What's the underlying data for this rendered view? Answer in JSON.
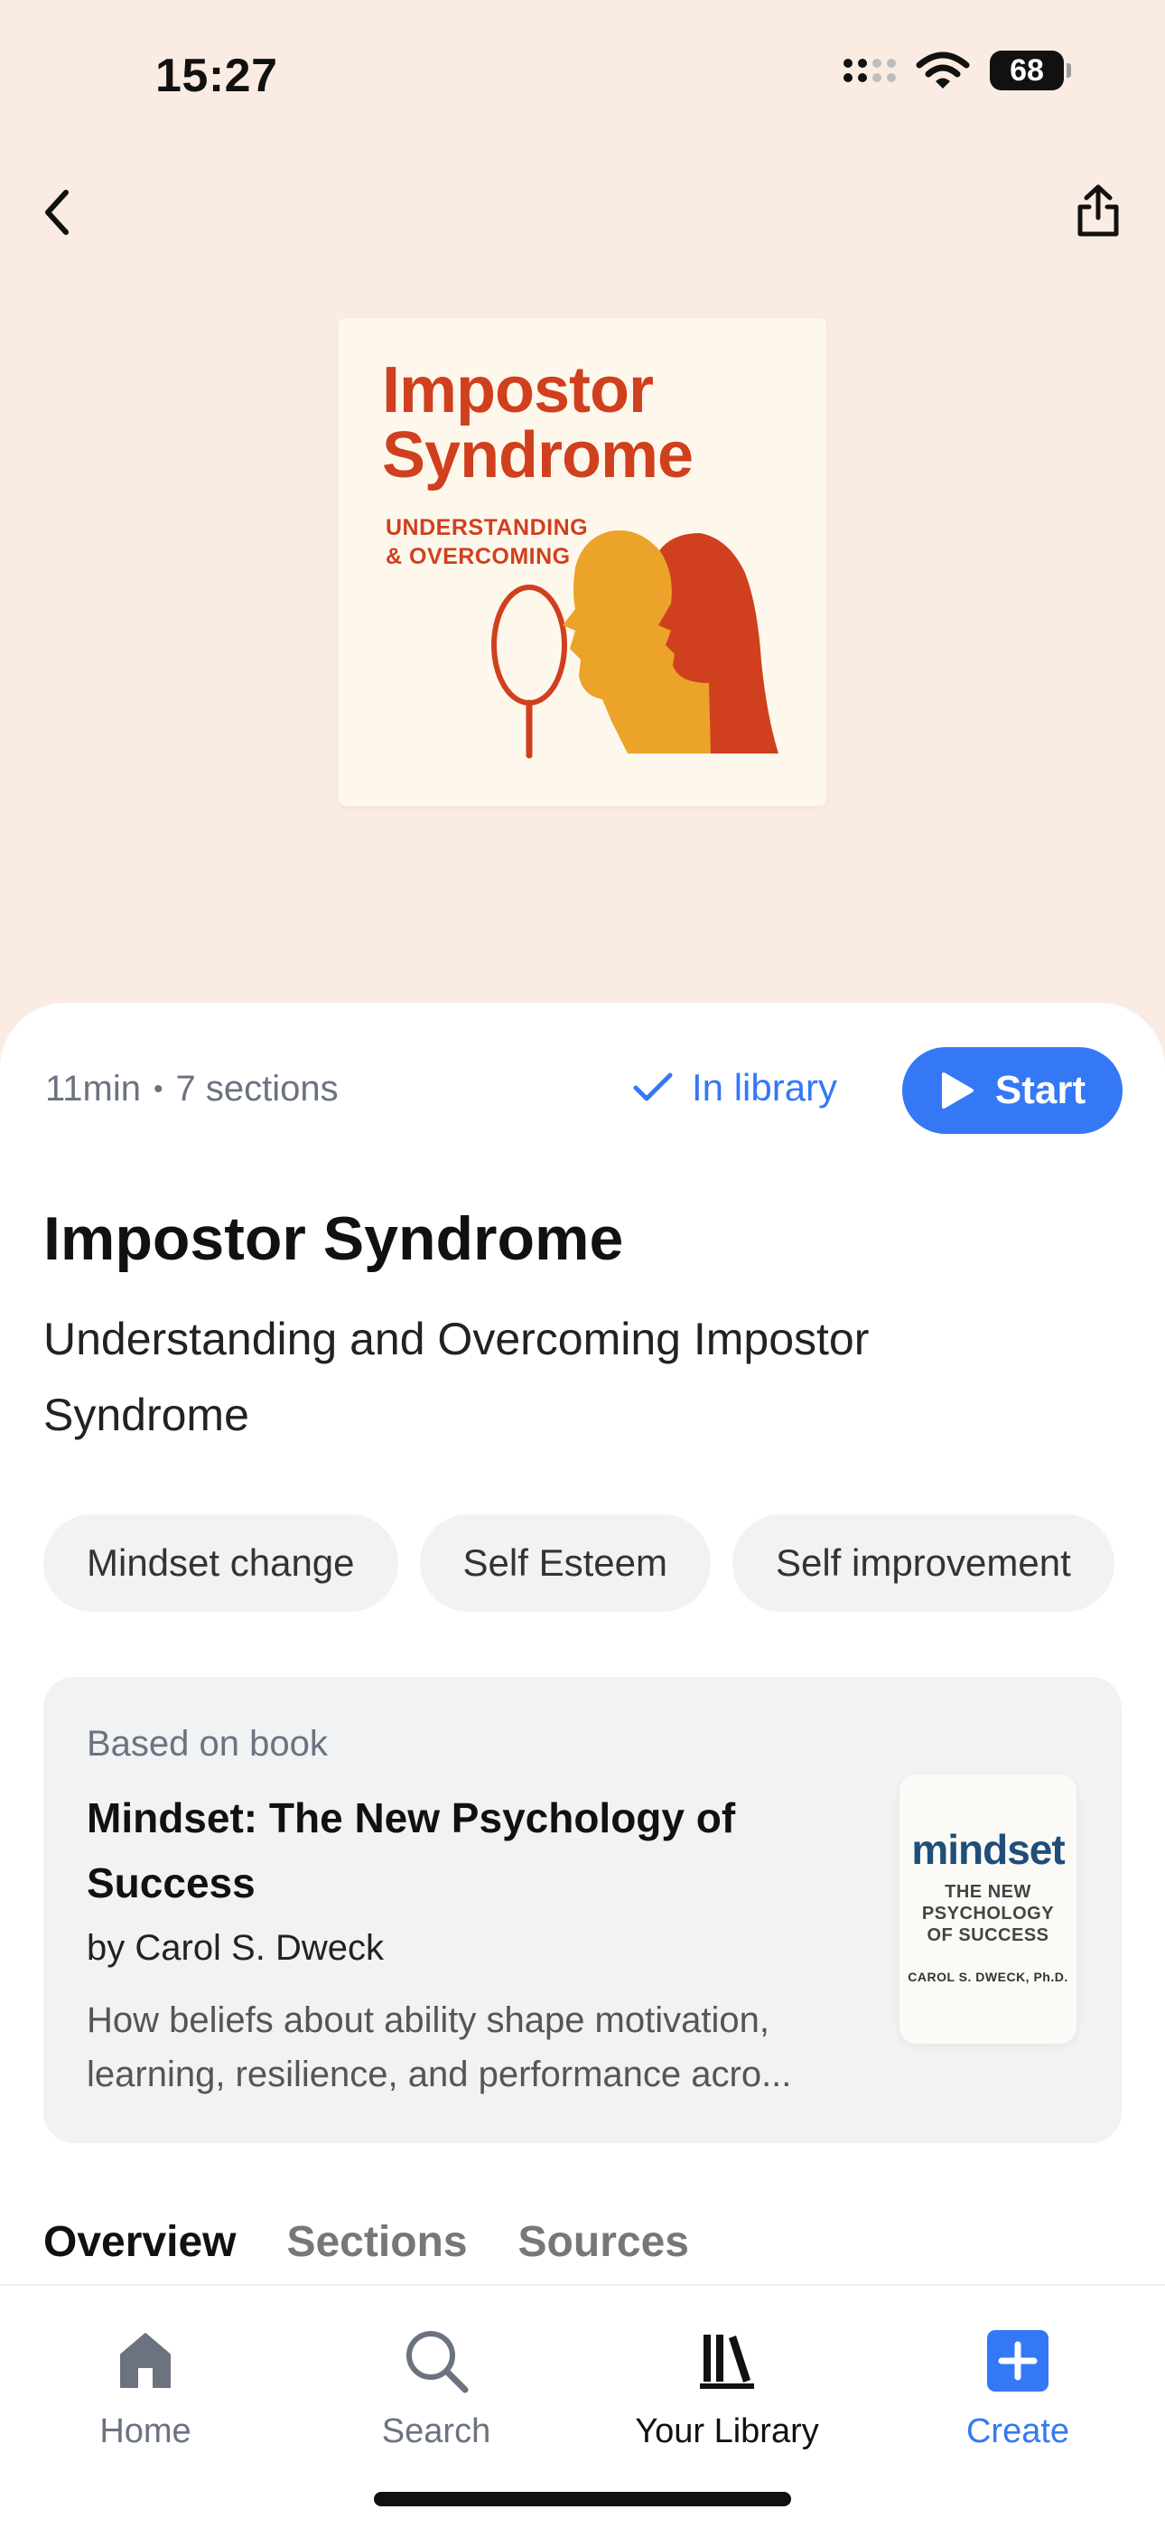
{
  "status_bar": {
    "time": "15:27",
    "battery": "68"
  },
  "cover": {
    "title_line1": "Impostor",
    "title_line2": "Syndrome",
    "subtitle_line1": "UNDERSTANDING",
    "subtitle_line2": "& OVERCOMING"
  },
  "meta": {
    "duration": "11min",
    "separator": "•",
    "sections": "7 sections",
    "in_library_label": "In library",
    "start_label": "Start"
  },
  "title": "Impostor Syndrome",
  "subtitle": "Understanding and Overcoming Impostor Syndrome",
  "tags": [
    "Mindset change",
    "Self Esteem",
    "Self improvement"
  ],
  "book": {
    "label": "Based on book",
    "title": "Mindset: The New Psychology of Success",
    "author": "by Carol S. Dweck",
    "description": "How beliefs about ability shape motivation, learning, resilience, and performance acro...",
    "cover_title": "mindset",
    "cover_subtitle": "THE NEW PSYCHOLOGY OF SUCCESS",
    "cover_author": "CAROL S. DWECK, Ph.D."
  },
  "section_tabs": [
    {
      "label": "Overview",
      "active": true
    },
    {
      "label": "Sections",
      "active": false
    },
    {
      "label": "Sources",
      "active": false
    }
  ],
  "tab_bar": {
    "home": "Home",
    "search": "Search",
    "library": "Your Library",
    "create": "Create"
  },
  "colors": {
    "accent": "#3478F6",
    "header_bg": "#FAECE2",
    "cover_red": "#D0401E",
    "cover_orange": "#EBA32A"
  },
  "icons": {
    "back": "chevron-left-icon",
    "share": "share-icon",
    "check": "checkmark-icon",
    "play": "play-icon",
    "home": "home-icon",
    "search": "search-icon",
    "library": "library-icon",
    "create": "plus-square-icon"
  }
}
